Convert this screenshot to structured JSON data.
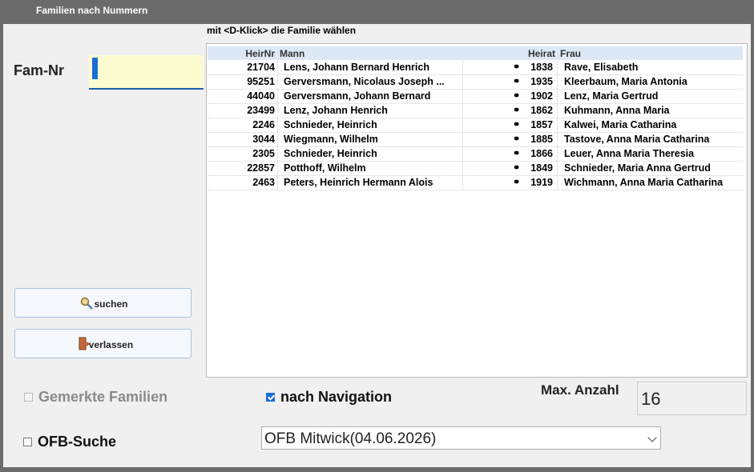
{
  "window": {
    "title": "Familien nach Nummern"
  },
  "hint": "mit <D-Klick> die Familie wählen",
  "fam_nr": {
    "label": "Fam-Nr",
    "value": ""
  },
  "buttons": {
    "search": "suchen",
    "exit": "verlassen"
  },
  "table": {
    "headers": {
      "nr": "HeirNr",
      "mann": "Mann",
      "heirat": "Heirat",
      "frau": "Frau"
    },
    "marriage_symbol": "⚭",
    "rows": [
      {
        "nr": "21704",
        "mann": "Lens, Johann Bernard Henrich",
        "heirat": "1838",
        "frau": "Rave, Elisabeth"
      },
      {
        "nr": "95251",
        "mann": "Gerversmann, Nicolaus Joseph ...",
        "heirat": "1935",
        "frau": "Kleerbaum, Maria Antonia"
      },
      {
        "nr": "44040",
        "mann": "Gerversmann, Johann Bernard",
        "heirat": "1902",
        "frau": "Lenz, Maria Gertrud"
      },
      {
        "nr": "23499",
        "mann": "Lenz, Johann Henrich",
        "heirat": "1862",
        "frau": "Kuhmann, Anna Maria"
      },
      {
        "nr": "2246",
        "mann": "Schnieder, Heinrich",
        "heirat": "1857",
        "frau": "Kalwei, Maria Catharina"
      },
      {
        "nr": "3044",
        "mann": "Wiegmann, Wilhelm",
        "heirat": "1885",
        "frau": "Tastove, Anna Maria Catharina"
      },
      {
        "nr": "2305",
        "mann": "Schnieder, Heinrich",
        "heirat": "1866",
        "frau": "Leuer, Anna Maria Theresia"
      },
      {
        "nr": "22857",
        "mann": "Potthoff, Wilhelm",
        "heirat": "1849",
        "frau": "Schnieder, Maria Anna Gertrud"
      },
      {
        "nr": "2463",
        "mann": "Peters, Heinrich Hermann Alois",
        "heirat": "1919",
        "frau": "Wichmann, Anna Maria Catharina"
      }
    ]
  },
  "options": {
    "gemerkte": {
      "label": "Gemerkte Familien",
      "checked": false,
      "enabled": false
    },
    "navigation": {
      "label": "nach Navigation",
      "checked": true
    },
    "ofb": {
      "label": "OFB-Suche",
      "checked": false
    }
  },
  "max": {
    "label": "Max. Anzahl",
    "value": "16"
  },
  "ofb_select": {
    "value": "OFB Mitwick(04.06.2026)"
  },
  "colors": {
    "accent": "#1a6ed6",
    "input_bg": "#fdfbd0",
    "header_bg": "#dce8f5"
  }
}
